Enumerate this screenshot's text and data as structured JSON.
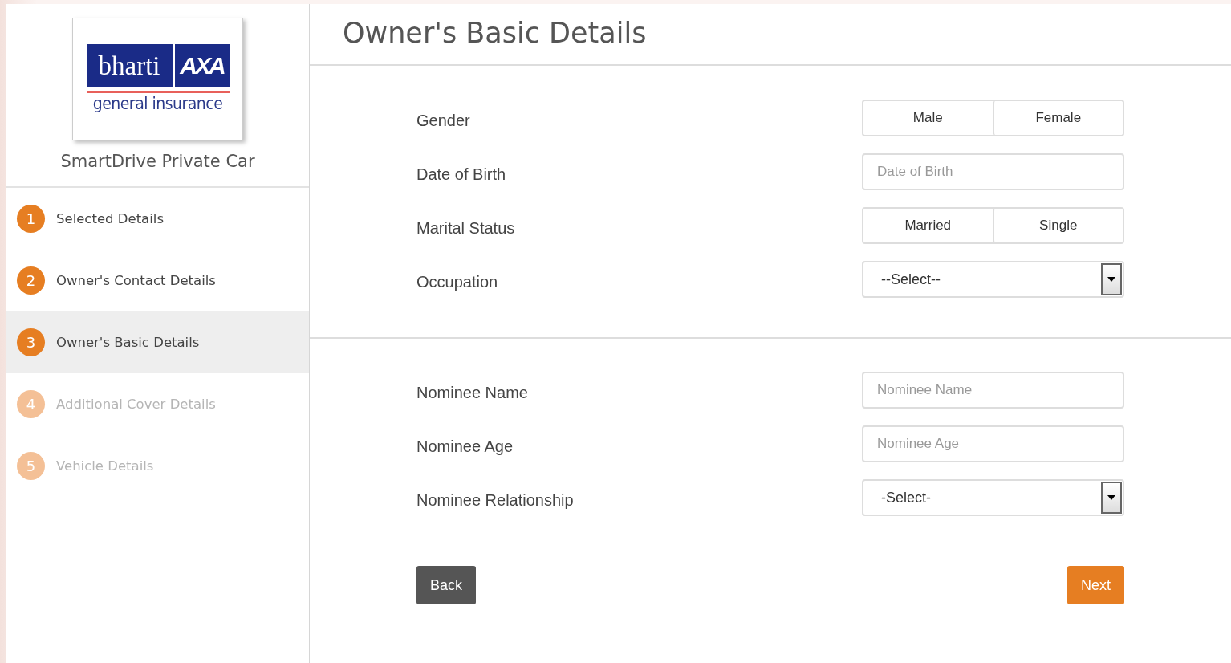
{
  "logo": {
    "brand": "bharti",
    "partner": "AXA",
    "tagline": "general insurance"
  },
  "product": "SmartDrive Private Car",
  "steps": [
    {
      "number": "1",
      "label": "Selected Details",
      "selected": false,
      "disabled": false
    },
    {
      "number": "2",
      "label": "Owner's Contact Details",
      "selected": false,
      "disabled": false
    },
    {
      "number": "3",
      "label": "Owner's Basic Details",
      "selected": true,
      "disabled": false
    },
    {
      "number": "4",
      "label": "Additional Cover Details",
      "selected": false,
      "disabled": true
    },
    {
      "number": "5",
      "label": "Vehicle Details",
      "selected": false,
      "disabled": true
    }
  ],
  "title": "Owner's Basic Details",
  "sections": [
    {
      "fields": [
        {
          "kind": "toggle",
          "label": "Gender",
          "options": [
            {
              "label": "Male",
              "selected": false
            },
            {
              "label": "Female",
              "selected": false
            }
          ]
        },
        {
          "kind": "text",
          "label": "Date of Birth",
          "placeholder": "Date of Birth"
        },
        {
          "kind": "toggle",
          "label": "Marital Status",
          "options": [
            {
              "label": "Married",
              "selected": false
            },
            {
              "label": "Single",
              "selected": false
            }
          ]
        },
        {
          "kind": "select",
          "label": "Occupation",
          "value": "--Select--"
        }
      ]
    },
    {
      "fields": [
        {
          "kind": "text",
          "label": "Nominee Name",
          "placeholder": "Nominee Name"
        },
        {
          "kind": "text",
          "label": "Nominee Age",
          "placeholder": "Nominee Age"
        },
        {
          "kind": "select",
          "label": "Nominee Relationship",
          "value": "-Select-"
        }
      ]
    }
  ],
  "buttons": [
    {
      "kind": "secondary",
      "label": "Back"
    },
    {
      "kind": "primary",
      "label": "Next"
    }
  ]
}
